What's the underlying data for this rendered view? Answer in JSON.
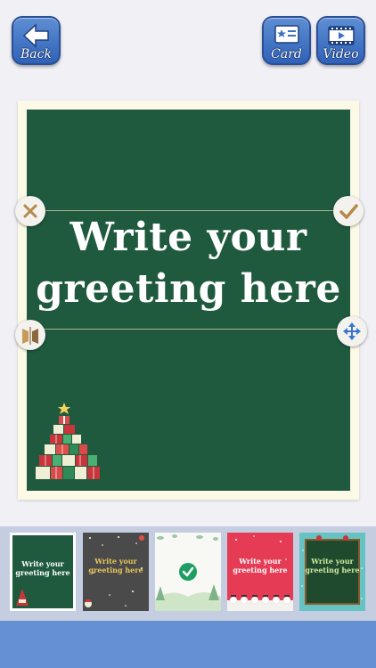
{
  "toolbar": {
    "back_label": "Back",
    "card_label": "Card",
    "video_label": "Video"
  },
  "card": {
    "greeting_line1": "Write your",
    "greeting_line2": "greeting here",
    "background_color": "#1f5a3f"
  },
  "thumbnails": [
    {
      "text_line1": "Write your",
      "text_line2": "greeting here",
      "selected": true
    },
    {
      "text_line1": "Write your",
      "text_line2": "greeting here",
      "selected": false
    },
    {
      "checked": true
    },
    {
      "text_line1": "Write your",
      "text_line2": "greeting here",
      "selected": false
    },
    {
      "text_line1": "Write your",
      "text_line2": "greeting here",
      "selected": false
    }
  ],
  "colors": {
    "button_blue": "#3b6fc2",
    "bottom_bar": "#6590d2",
    "strip": "#c4cee0"
  }
}
